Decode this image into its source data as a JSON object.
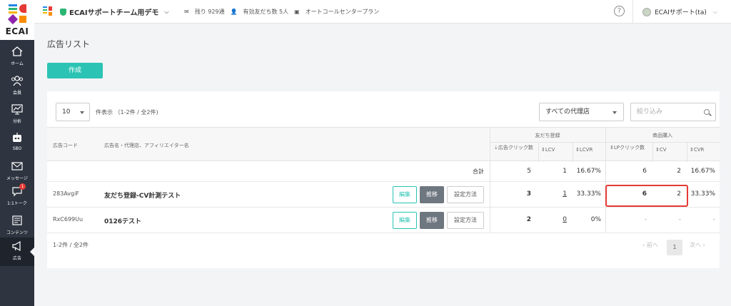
{
  "sidebar": {
    "logo_text": "ECAI",
    "items": [
      {
        "label": "ホーム",
        "icon": "home-icon"
      },
      {
        "label": "会員",
        "icon": "members-icon"
      },
      {
        "label": "分析",
        "icon": "analytics-icon"
      },
      {
        "label": "SBO",
        "icon": "robot-icon"
      },
      {
        "label": "メッセージ",
        "icon": "message-icon"
      },
      {
        "label": "1:1トーク",
        "icon": "chat-icon",
        "badge": "1"
      },
      {
        "label": "コンテンツ",
        "icon": "content-icon"
      },
      {
        "label": "広告",
        "icon": "megaphone-icon",
        "active": true
      }
    ]
  },
  "topbar": {
    "account": "ECAIサポートチーム用デモ",
    "remaining": "残り 929通",
    "friends": "有効友だち数 5人",
    "plan": "オートコールセンタープラン",
    "help": "?",
    "user": "ECAIサポート(ta)"
  },
  "page": {
    "title": "広告リスト",
    "create_label": "作成"
  },
  "controls": {
    "page_size": "10",
    "showing": "件表示 （1-2件 / 全2件)",
    "agency": "すべての代理店",
    "filter_placeholder": "絞り込み"
  },
  "table": {
    "group_friends": "友だち登録",
    "group_purchase": "商品購入",
    "headers": {
      "code": "広告コード",
      "name": "広告名・代理店、アフィリエイター名",
      "ad_clicks": "広告クリック数",
      "lcv": "LCV",
      "lcvr": "LCVR",
      "lp_clicks": "LPクリック数",
      "cv": "CV",
      "cvr": "CVR"
    },
    "total": {
      "label": "合計",
      "ad_clicks": "5",
      "lcv": "1",
      "lcvr": "16.67%",
      "lp_clicks": "6",
      "cv": "2",
      "cvr": "16.67%"
    },
    "rows": [
      {
        "code": "283AvgiF",
        "name": "友だち登録-CV計測テスト",
        "ad_clicks": "3",
        "lcv": "1",
        "lcvr": "33.33%",
        "lp_clicks": "6",
        "cv": "2",
        "cvr": "33.33%"
      },
      {
        "code": "RxC699Uu",
        "name": "0126テスト",
        "ad_clicks": "2",
        "lcv": "0",
        "lcvr": "0%",
        "lp_clicks": "-",
        "cv": "-",
        "cvr": "-"
      }
    ],
    "btn_edit": "編集",
    "btn_move": "推移",
    "btn_settings": "設定方法"
  },
  "footer": {
    "count": "1-2件 / 全2件",
    "prev": "‹ 前へ",
    "page": "1",
    "next": "次へ ›"
  },
  "colors": {
    "accent": "#2bc4b4",
    "sidebar": "#2e3440",
    "highlight": "#e53935"
  }
}
